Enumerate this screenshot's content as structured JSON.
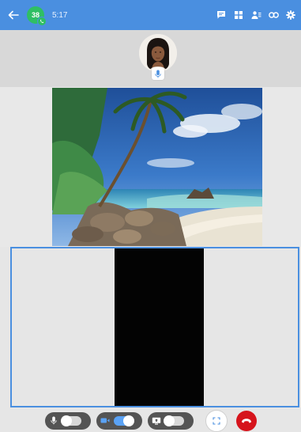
{
  "topbar": {
    "avatar_badge": "38",
    "call_timer": "5:17",
    "accent_color": "#4a8fe0",
    "icons": [
      "back-arrow-icon",
      "chat-icon",
      "grid-view-icon",
      "participants-icon",
      "link-icon",
      "settings-icon"
    ]
  },
  "participant_strip": {
    "icons": [
      "participant-avatar",
      "microphone-icon"
    ]
  },
  "controls": {
    "mic_toggle": {
      "icon": "microphone-icon",
      "state": "off"
    },
    "camera_toggle": {
      "icon": "camera-icon",
      "state": "on"
    },
    "screen_share_toggle": {
      "icon": "screen-share-icon",
      "state": "off"
    },
    "fullscreen": {
      "icon": "fullscreen-icon"
    },
    "hangup": {
      "icon": "hang-up-icon",
      "color": "#d6141c"
    }
  }
}
